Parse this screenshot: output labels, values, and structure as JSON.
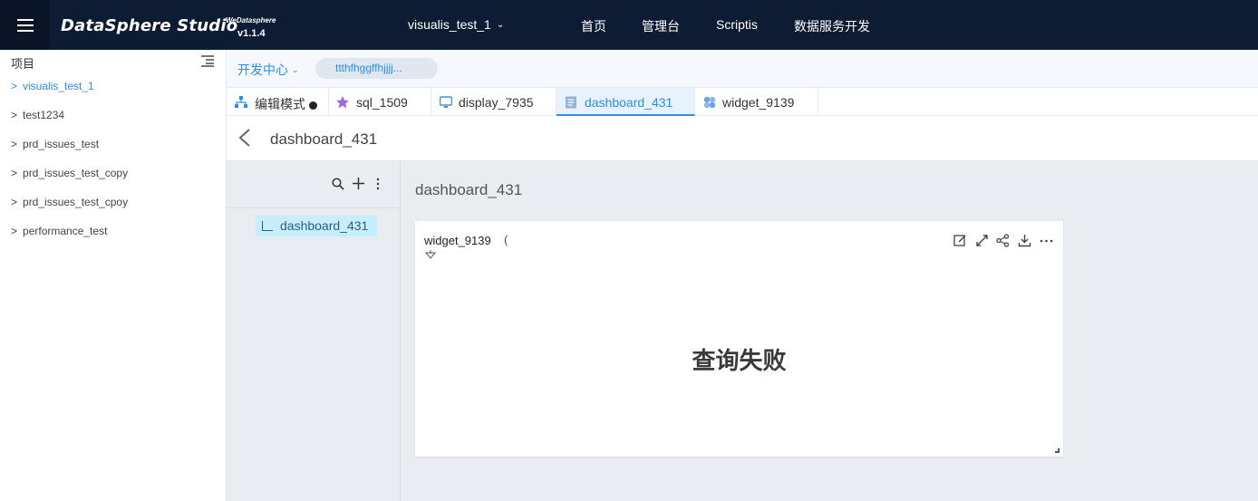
{
  "topbar": {
    "brand": "DataSphere Studio",
    "brand_sub": "WeDatasphere",
    "version": "v1.1.4",
    "project": "visualis_test_1",
    "nav": [
      "首页",
      "管理台",
      "Scriptis",
      "数据服务开发"
    ]
  },
  "sidebar": {
    "header": "项目",
    "items": [
      {
        "label": "visualis_test_1",
        "active": true
      },
      {
        "label": "test1234"
      },
      {
        "label": "prd_issues_test"
      },
      {
        "label": "prd_issues_test_copy"
      },
      {
        "label": "prd_issues_test_cpoy"
      },
      {
        "label": "performance_test"
      }
    ]
  },
  "breadcrumb": {
    "dev_center": "开发中心",
    "chip": "ttthfhggffhjjjj..."
  },
  "tabs": [
    {
      "label": "编辑模式",
      "icon": "workflow-icon"
    },
    {
      "label": "sql_1509",
      "icon": "sql-icon"
    },
    {
      "label": "display_7935",
      "icon": "display-icon"
    },
    {
      "label": "dashboard_431",
      "icon": "dashboard-icon",
      "active": true
    },
    {
      "label": "widget_9139",
      "icon": "widget-icon"
    }
  ],
  "title": "dashboard_431",
  "left_pane": {
    "item": "dashboard_431"
  },
  "dashboard": {
    "title": "dashboard_431",
    "widget": {
      "name": "widget_9139",
      "paren": "(",
      "message": "查询失败"
    }
  },
  "colors": {
    "topbar": "#0d1b33",
    "accent": "#2d8cf0",
    "workspace": "#e9ecf1"
  }
}
